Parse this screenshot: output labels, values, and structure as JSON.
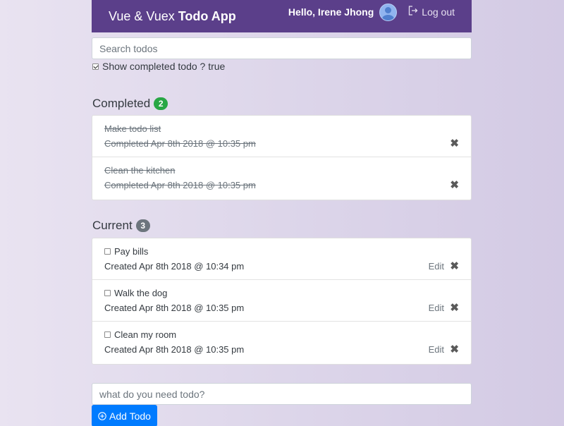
{
  "navbar": {
    "brand_prefix": "Vue & Vuex",
    "brand_strong": "Todo App",
    "greeting": "Hello, Irene Jhong",
    "logout_label": "Log out"
  },
  "search": {
    "placeholder": "Search todos"
  },
  "filter": {
    "label": "Show completed todo ? true",
    "checked": true
  },
  "completed": {
    "title": "Completed",
    "count": "2",
    "items": [
      {
        "title": "Make todo list",
        "status": "Completed Apr 8th 2018 @ 10:35 pm"
      },
      {
        "title": "Clean the kitchen",
        "status": "Completed Apr 8th 2018 @ 10:35 pm"
      }
    ]
  },
  "current": {
    "title": "Current",
    "count": "3",
    "edit_label": "Edit",
    "items": [
      {
        "title": "Pay bills",
        "status": "Created Apr 8th 2018 @ 10:34 pm"
      },
      {
        "title": "Walk the dog",
        "status": "Created Apr 8th 2018 @ 10:35 pm"
      },
      {
        "title": "Clean my room",
        "status": "Created Apr 8th 2018 @ 10:35 pm"
      }
    ]
  },
  "new_todo": {
    "placeholder": "what do you need todo?",
    "button_label": "Add Todo"
  },
  "icons": {
    "delete": "times-icon",
    "logout": "sign-out-icon",
    "add": "plus-circle-icon",
    "avatar": "user-avatar-icon"
  },
  "colors": {
    "navbar": "#5b3f8a",
    "completed_badge": "#28a745",
    "current_badge": "#6c757d",
    "primary_button": "#007bff"
  }
}
